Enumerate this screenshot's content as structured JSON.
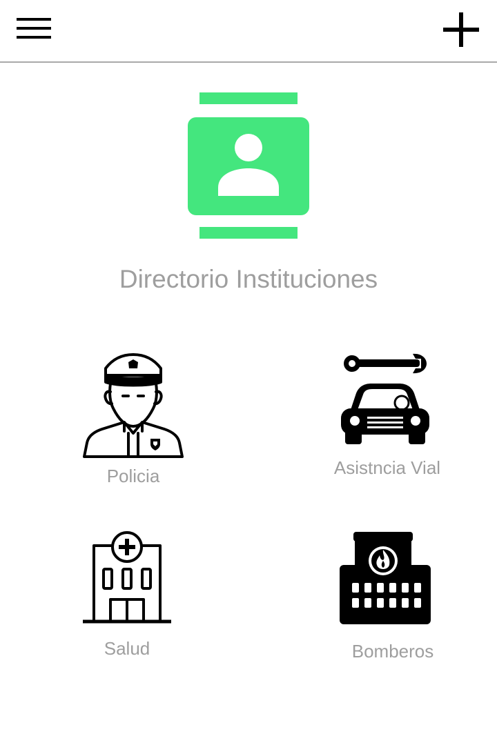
{
  "header": {
    "menu_icon": "hamburger-menu-icon",
    "add_icon": "plus-icon"
  },
  "hero": {
    "icon": "contact-book-icon",
    "title": "Directorio Instituciones",
    "accent_color": "#44e67e"
  },
  "categories": [
    {
      "label": "Policia",
      "icon": "police-officer-icon"
    },
    {
      "label": "Asistncia Vial",
      "icon": "car-repair-icon"
    },
    {
      "label": "Salud",
      "icon": "hospital-icon"
    },
    {
      "label": "Bomberos",
      "icon": "fire-station-icon"
    }
  ],
  "colors": {
    "icon": "#000000",
    "label": "#9e9e9e",
    "divider": "#a9a9a9"
  }
}
